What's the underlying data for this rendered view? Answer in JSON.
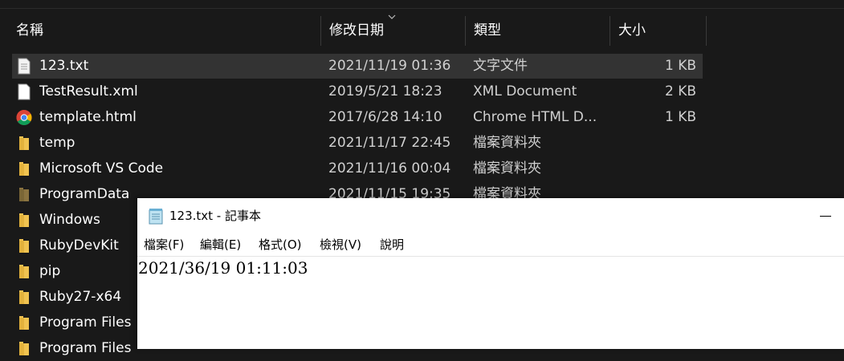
{
  "explorer": {
    "columns": {
      "name": "名稱",
      "date_modified": "修改日期",
      "type": "類型",
      "size": "大小"
    },
    "sort_indicator_icon": "chevron-down-icon",
    "files": [
      {
        "name": "123.txt",
        "date": "2021/11/19 01:36",
        "type": "文字文件",
        "size": "1 KB",
        "icon": "text-file-icon",
        "selected": true
      },
      {
        "name": "TestResult.xml",
        "date": "2019/5/21 18:23",
        "type": "XML Document",
        "size": "2 KB",
        "icon": "xml-file-icon"
      },
      {
        "name": "template.html",
        "date": "2017/6/28 14:10",
        "type": "Chrome HTML D...",
        "size": "1 KB",
        "icon": "chrome-icon"
      },
      {
        "name": "temp",
        "date": "2021/11/17 22:45",
        "type": "檔案資料夾",
        "size": "",
        "icon": "folder-icon"
      },
      {
        "name": "Microsoft VS Code",
        "date": "2021/11/16 00:04",
        "type": "檔案資料夾",
        "size": "",
        "icon": "folder-icon"
      },
      {
        "name": "ProgramData",
        "date": "2021/11/15 19:35",
        "type": "檔案資料夾",
        "size": "",
        "icon": "folder-icon-hidden"
      },
      {
        "name": "Windows",
        "date": "",
        "type": "",
        "size": "",
        "icon": "folder-icon"
      },
      {
        "name": "RubyDevKit",
        "date": "",
        "type": "",
        "size": "",
        "icon": "folder-icon"
      },
      {
        "name": "pip",
        "date": "",
        "type": "",
        "size": "",
        "icon": "folder-icon"
      },
      {
        "name": "Ruby27-x64",
        "date": "",
        "type": "",
        "size": "",
        "icon": "folder-icon"
      },
      {
        "name": "Program Files",
        "date": "",
        "type": "",
        "size": "",
        "icon": "folder-icon"
      },
      {
        "name": "Program Files",
        "date": "",
        "type": "",
        "size": "",
        "icon": "folder-icon"
      }
    ],
    "colors": {
      "background": "#191919",
      "selected_row": "#333333",
      "folder": "#f0c350",
      "folder_hidden": "#8a7340"
    }
  },
  "notepad": {
    "title": "123.txt - 記事本",
    "menu": [
      "檔案(F)",
      "編輯(E)",
      "格式(O)",
      "檢視(V)",
      "說明"
    ],
    "content": "2021/36/19 01:11:03"
  }
}
